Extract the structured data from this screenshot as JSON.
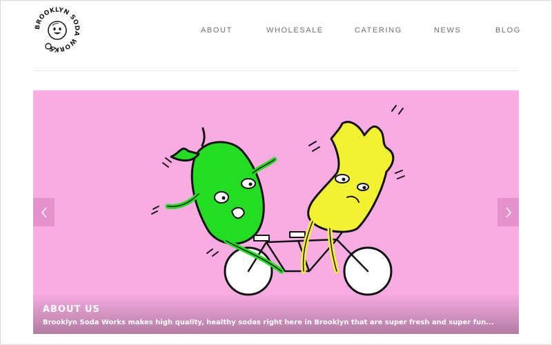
{
  "brand": {
    "name": "BROOKLYN SODA WORKS",
    "colors": {
      "text": "#1a1a1a",
      "nav": "#6f6f6f",
      "slide_bg": "#f8ace2",
      "apple": "#22dd22",
      "ginger": "#f2f233"
    }
  },
  "nav": {
    "items": [
      {
        "label": "ABOUT"
      },
      {
        "label": "WHOLESALE"
      },
      {
        "label": "CATERING"
      },
      {
        "label": "NEWS"
      },
      {
        "label": "BLOG"
      }
    ]
  },
  "slider": {
    "prev_icon": "chevron-left-icon",
    "next_icon": "chevron-right-icon",
    "illustration": "apple-and-ginger-riding-tandem-bicycle",
    "caption": {
      "title": "ABOUT US",
      "text": "Brooklyn Soda Works makes high quality, healthy sodas right here in Brooklyn that are super fresh and super fun..."
    }
  }
}
